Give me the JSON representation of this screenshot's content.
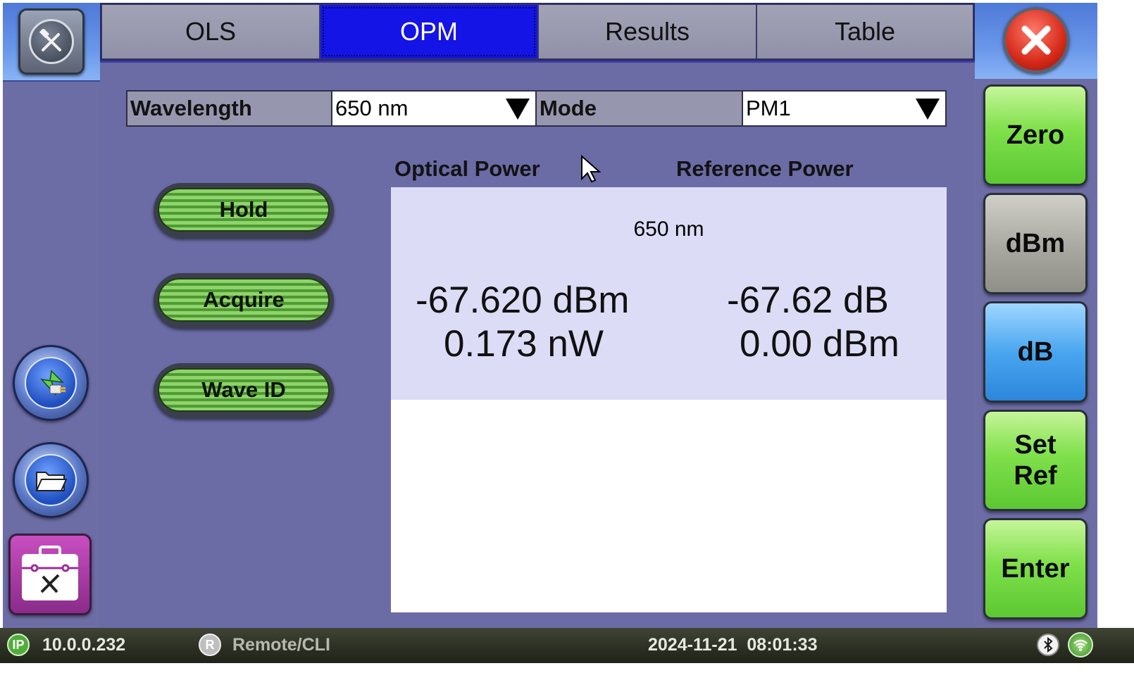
{
  "tabs": {
    "ols": "OLS",
    "opm": "OPM",
    "results": "Results",
    "table": "Table",
    "active": "OPM"
  },
  "settings": {
    "wavelength_label": "Wavelength",
    "wavelength_value": "650 nm",
    "mode_label": "Mode",
    "mode_value": "PM1"
  },
  "actions": {
    "hold": "Hold",
    "acquire": "Acquire",
    "wave_id": "Wave ID"
  },
  "readout": {
    "optical_power_heading": "Optical Power",
    "reference_power_heading": "Reference Power",
    "wavelength": "650 nm",
    "optical_dbm": "-67.620 dBm",
    "optical_nw": "0.173 nW",
    "reference_db": "-67.62 dB",
    "reference_dbm": "0.00 dBm"
  },
  "side_buttons": {
    "zero": "Zero",
    "dbm": "dBm",
    "db": "dB",
    "set_ref_line1": "Set",
    "set_ref_line2": "Ref",
    "enter": "Enter"
  },
  "status_bar": {
    "ip_badge": "IP",
    "ip_address": "10.0.0.232",
    "remote_badge": "R",
    "remote_label": "Remote/CLI",
    "datetime": "2024-11-21  08:01:33"
  },
  "icons": {
    "settings": "tools-icon",
    "close": "close-icon",
    "connect": "connector-icon",
    "files": "folder-icon",
    "toolbox": "toolbox-icon",
    "bluetooth": "bluetooth-icon",
    "wifi": "wifi-icon"
  },
  "colors": {
    "active_tab": "#1414e6",
    "content_bg": "#6b6ba6",
    "zero_button": "#7fe04a",
    "dbm_button": "#a8a8a0",
    "db_button": "#4aa6f0"
  }
}
